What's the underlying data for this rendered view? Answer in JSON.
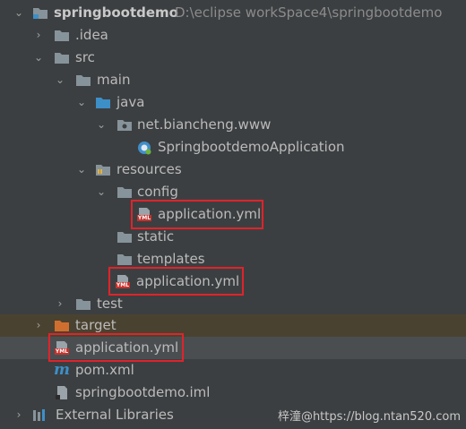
{
  "project": {
    "name": "springbootdemo",
    "path": "D:\\eclipse workSpace4\\springbootdemo"
  },
  "tree": {
    "idea": ".idea",
    "src": "src",
    "main": "main",
    "java": "java",
    "package": "net.biancheng.www",
    "app_class": "SpringbootdemoApplication",
    "resources": "resources",
    "config": "config",
    "config_yml": "application.yml",
    "static": "static",
    "templates": "templates",
    "resources_yml": "application.yml",
    "test": "test",
    "target": "target",
    "root_yml": "application.yml",
    "pom": "pom.xml",
    "iml": "springbootdemo.iml",
    "ext_libs": "External Libraries"
  },
  "badges": {
    "yml": "YML"
  },
  "watermark": "梓潼@https://blog.ntan520.com",
  "colors": {
    "folder": "#87939a",
    "source_folder": "#3d8fc8",
    "excluded_folder": "#cf6f2f",
    "highlight_box": "#e0232b",
    "yml_badge": "#c7322d"
  }
}
